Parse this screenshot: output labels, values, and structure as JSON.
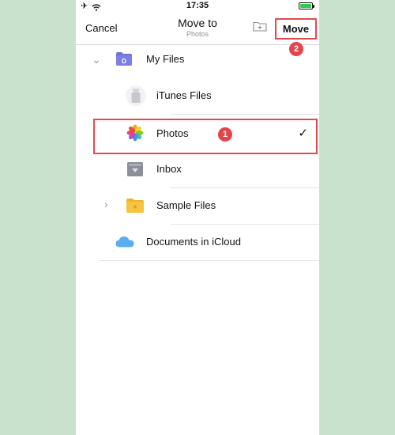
{
  "status_bar": {
    "time": "17:35"
  },
  "nav": {
    "cancel_label": "Cancel",
    "title": "Move to",
    "subtitle": "Photos",
    "move_label": "Move"
  },
  "badges": {
    "one": "1",
    "two": "2"
  },
  "tree": {
    "my_files": "My Files",
    "itunes_files": "iTunes Files",
    "photos": "Photos",
    "inbox": "Inbox",
    "sample_files": "Sample Files",
    "icloud": "Documents in iCloud"
  },
  "selected_item": "Photos",
  "colors": {
    "highlight_red": "#e24a4f",
    "folder_purple": "#6f72d8",
    "folder_yellow": "#f6c342",
    "background_green": "#c9e2cd"
  },
  "icons": {
    "my_files": "purple-folder-icon",
    "itunes_files": "usb-drive-icon",
    "photos": "photos-flower-icon",
    "inbox": "inbox-tray-icon",
    "sample_files": "yellow-folder-icon",
    "icloud": "icloud-icon"
  }
}
